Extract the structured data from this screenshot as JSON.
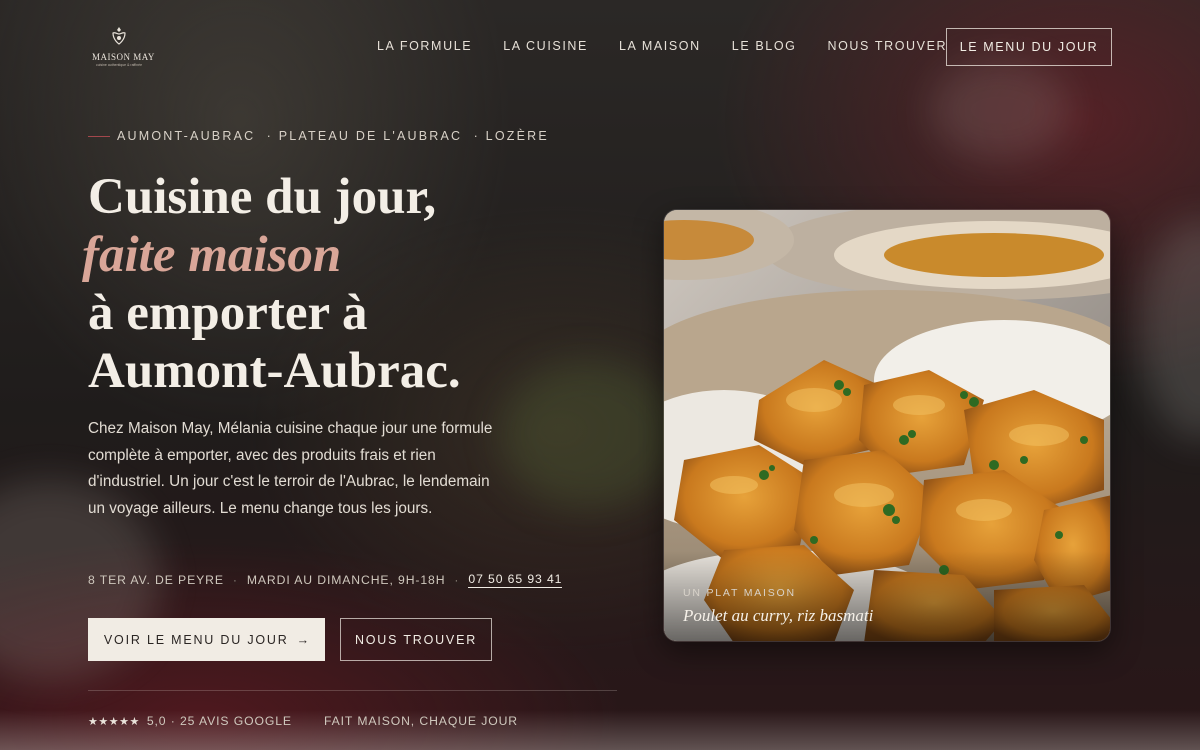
{
  "brand": {
    "name": "MAISON MAY",
    "tagline": "cuisine authentique & raffinée"
  },
  "nav": {
    "links": [
      "LA FORMULE",
      "LA CUISINE",
      "LA MAISON",
      "LE BLOG",
      "NOUS TROUVER"
    ],
    "cta": "LE MENU DU JOUR"
  },
  "hero": {
    "eyebrow": "AUMONT-AUBRAC  · PLATEAU DE L'AUBRAC  · LOZÈRE",
    "headline": {
      "line1": "Cuisine du jour,",
      "accent": "faite maison",
      "line3": "à emporter à",
      "line4": "Aumont-Aubrac."
    },
    "intro": "Chez Maison May, Mélania cuisine chaque jour une formule complète à emporter, avec des produits frais et rien d'industriel. Un jour c'est le terroir de l'Aubrac, le lendemain un voyage ailleurs. Le menu change tous les jours.",
    "info": {
      "address": "8 TER AV. DE PEYRE",
      "hours": "MARDI AU DIMANCHE, 9H-18H",
      "phone": "07 50 65 93 41",
      "separator": "·"
    },
    "primary_button": "VOIR LE MENU DU JOUR",
    "primary_arrow": "→",
    "secondary_button": "NOUS TROUVER",
    "proof": {
      "stars": "★★★★★",
      "rating": "5,0 · 25 AVIS GOOGLE",
      "tagline": "FAIT MAISON, CHAQUE JOUR"
    }
  },
  "card": {
    "kicker": "UN PLAT MAISON",
    "caption": "Poulet au curry, riz basmati"
  },
  "colors": {
    "accent_rose": "#d9a698",
    "cream": "#f1ece4",
    "burgundy": "#a3474c"
  }
}
